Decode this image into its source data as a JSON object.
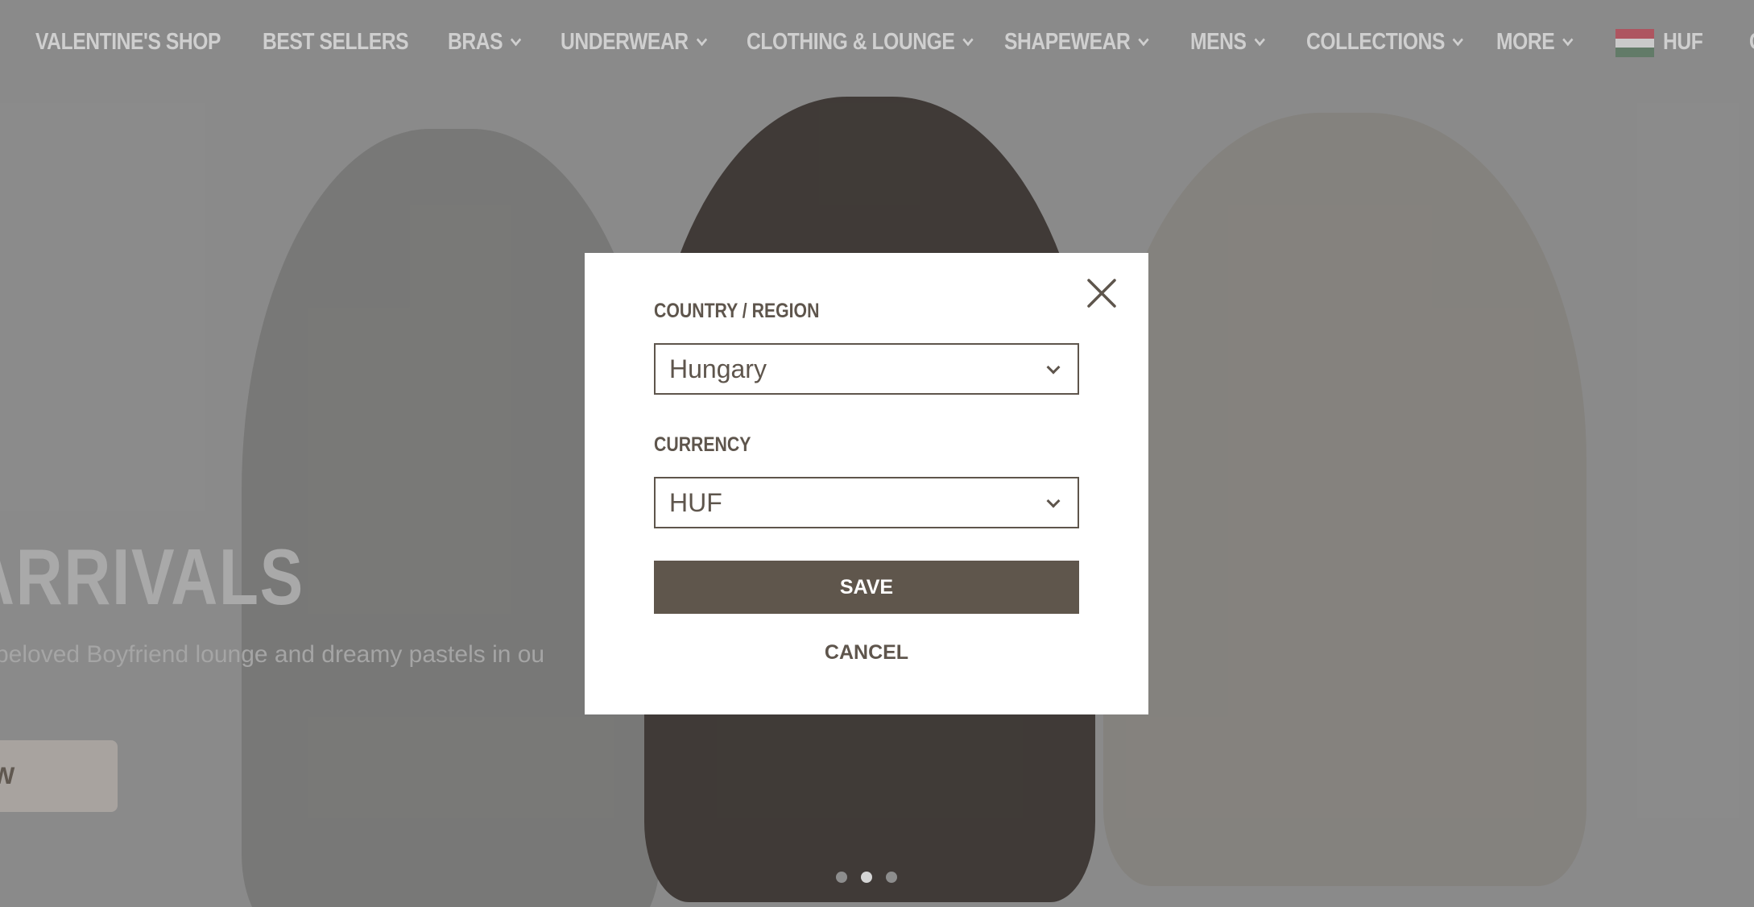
{
  "nav": {
    "items": [
      {
        "label": "VALENTINE'S SHOP",
        "dropdown": false
      },
      {
        "label": "BEST SELLERS",
        "dropdown": false
      },
      {
        "label": "BRAS",
        "dropdown": true
      },
      {
        "label": "UNDERWEAR",
        "dropdown": true
      },
      {
        "label": "CLOTHING & LOUNGE",
        "dropdown": true
      },
      {
        "label": "SHAPEWEAR",
        "dropdown": true
      },
      {
        "label": "MENS",
        "dropdown": true
      },
      {
        "label": "COLLECTIONS",
        "dropdown": true
      },
      {
        "label": "MORE",
        "dropdown": true
      }
    ],
    "currency_label": "HUF",
    "flag_icon": "hungary-flag-icon",
    "flag_colors": [
      "#cd2a3e",
      "#ffffff",
      "#436f4d"
    ],
    "partial_item": "C"
  },
  "hero": {
    "title": "ARRIVALS",
    "subtitle": "beloved Boyfriend lounge and dreamy pastels in ou",
    "button_label": "W",
    "carousel_active": 2,
    "carousel_count": 3
  },
  "modal": {
    "country_label": "COUNTRY / REGION",
    "country_value": "Hungary",
    "currency_label": "CURRENCY",
    "currency_value": "HUF",
    "save_label": "SAVE",
    "cancel_label": "CANCEL",
    "close_icon": "close-icon"
  },
  "colors": {
    "accent": "#5f564c",
    "modal_bg": "#ffffff"
  }
}
